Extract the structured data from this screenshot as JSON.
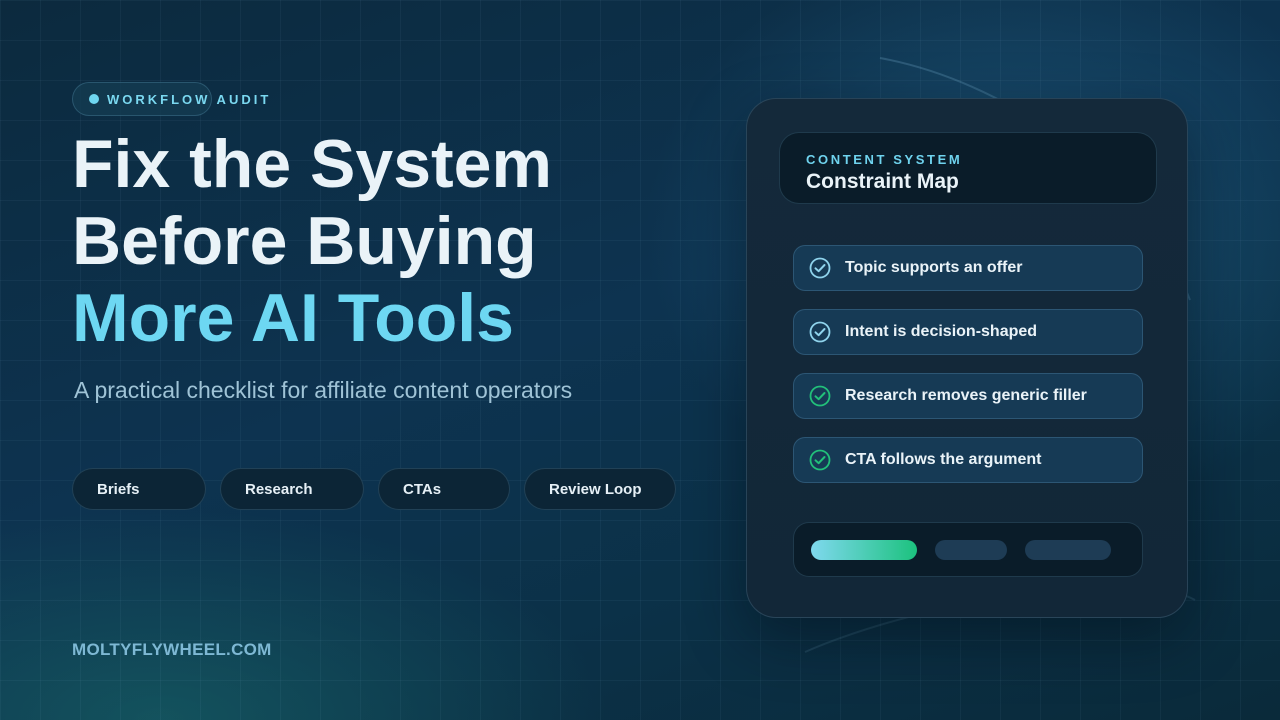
{
  "badge": {
    "label": "WORKFLOW AUDIT"
  },
  "headline": {
    "line1": "Fix the System",
    "line2": "Before Buying",
    "line3": "More AI Tools"
  },
  "subtitle": "A practical checklist for affiliate content operators",
  "tags": [
    "Briefs",
    "Research",
    "CTAs",
    "Review Loop"
  ],
  "footer": {
    "site": "MOLTYFLYWHEEL.COM"
  },
  "card": {
    "eyebrow": "CONTENT SYSTEM",
    "title": "Constraint Map",
    "checklist": [
      {
        "label": "Topic supports an offer",
        "checked": true,
        "check_color": "#8fd3ec"
      },
      {
        "label": "Intent is decision-shaped",
        "checked": true,
        "check_color": "#8fd3ec"
      },
      {
        "label": "Research removes generic filler",
        "checked": true,
        "check_color": "#22c07a"
      },
      {
        "label": "CTA follows the argument",
        "checked": true,
        "check_color": "#22c07a"
      }
    ],
    "progress": {
      "completed_segments": 1,
      "total_segments": 3
    }
  },
  "colors": {
    "accent": "#6dd7f2",
    "success": "#22c07a",
    "background": "#0d3350"
  }
}
